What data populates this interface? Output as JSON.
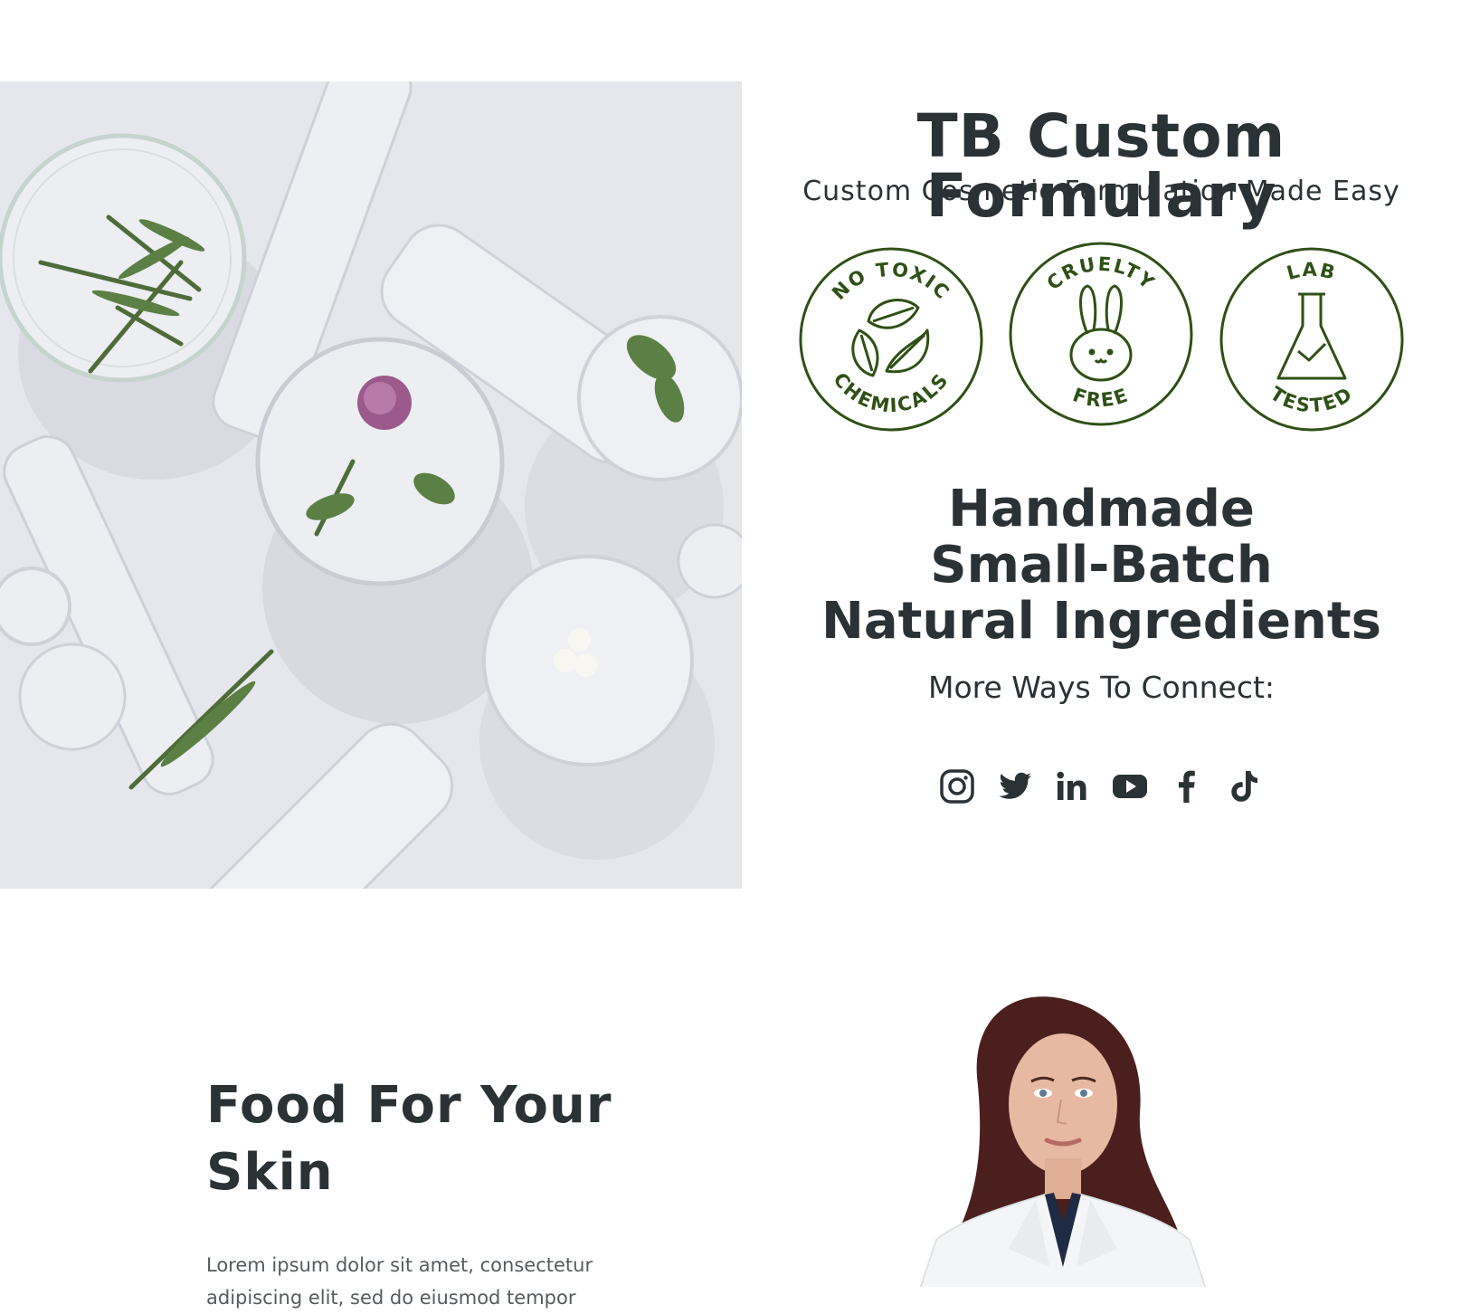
{
  "hero": {
    "brand_title": "TB Custom Formulary",
    "brand_subtitle": "Custom Cosmetic Formulation Made Easy",
    "badges": [
      {
        "top_text": "NO TOXIC",
        "bottom_text": "CHEMICALS",
        "icon": "leaves-icon"
      },
      {
        "top_text": "CRUELTY",
        "bottom_text": "FREE",
        "icon": "bunny-icon"
      },
      {
        "top_text": "LAB",
        "bottom_text": "TESTED",
        "icon": "flask-icon"
      }
    ],
    "tagline": [
      "Handmade",
      "Small-Batch",
      "Natural Ingredients"
    ],
    "connect_label": "More Ways To Connect:",
    "socials": [
      "instagram-icon",
      "twitter-icon",
      "linkedin-icon",
      "youtube-icon",
      "facebook-icon",
      "tiktok-icon"
    ]
  },
  "about": {
    "title_line1": "Food For Your",
    "title_line2": "Skin",
    "body": "Lorem ipsum dolor sit amet, consectetur adipiscing elit, sed do eiusmod tempor"
  },
  "colors": {
    "text_dark": "#2b3236",
    "badge_green": "#2f5016",
    "hero_bg": "#e7e8ee"
  }
}
